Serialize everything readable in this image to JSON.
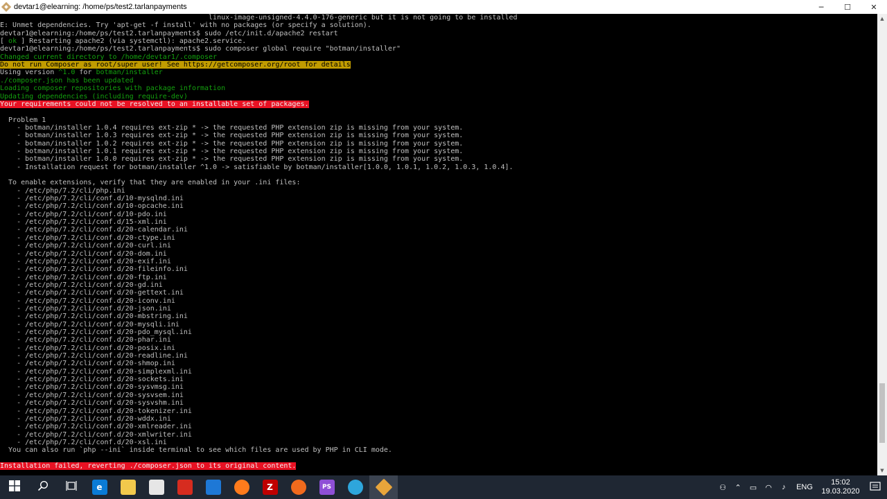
{
  "window": {
    "title": "devtar1@elearning: /home/ps/test2.tarlanpayments",
    "icon": "git-bash-icon",
    "controls": {
      "minimize": "─",
      "maximize": "☐",
      "close": "✕"
    }
  },
  "terminal": {
    "lines": [
      {
        "text": "                                                  linux-image-unsigned-4.4.0-176-generic but it is not going to be installed",
        "style": "normal"
      },
      {
        "text": "E: Unmet dependencies. Try 'apt-get -f install' with no packages (or specify a solution).",
        "style": "normal"
      },
      {
        "text": "devtar1@elearning:/home/ps/test2.tarlanpayments$ sudo /etc/init.d/apache2 restart",
        "style": "normal"
      },
      {
        "prefix": "[ ",
        "highlight": "ok",
        "suffix": " ] Restarting apache2 (via systemctl): apache2.service.",
        "style": "ok"
      },
      {
        "text": "devtar1@elearning:/home/ps/test2.tarlanpayments$ sudo composer global require \"botman/installer\"",
        "style": "normal"
      },
      {
        "text": "Changed current directory to /home/devtar1/.composer",
        "style": "green"
      },
      {
        "text": "Do not run Composer as root/super user! See https://getcomposer.org/root for details",
        "style": "warning"
      },
      {
        "prefix": "Using version ",
        "highlight": "^1.0",
        "middle": " for ",
        "highlight2": "botman/installer",
        "style": "version"
      },
      {
        "text": "./composer.json has been updated",
        "style": "green"
      },
      {
        "text": "Loading composer repositories with package information",
        "style": "green"
      },
      {
        "text": "Updating dependencies (including require-dev)",
        "style": "green"
      },
      {
        "text": "Your requirements could not be resolved to an installable set of packages.",
        "style": "error"
      },
      {
        "text": "",
        "style": "normal"
      },
      {
        "text": "  Problem 1",
        "style": "normal"
      },
      {
        "text": "    - botman/installer 1.0.4 requires ext-zip * -> the requested PHP extension zip is missing from your system.",
        "style": "normal"
      },
      {
        "text": "    - botman/installer 1.0.3 requires ext-zip * -> the requested PHP extension zip is missing from your system.",
        "style": "normal"
      },
      {
        "text": "    - botman/installer 1.0.2 requires ext-zip * -> the requested PHP extension zip is missing from your system.",
        "style": "normal"
      },
      {
        "text": "    - botman/installer 1.0.1 requires ext-zip * -> the requested PHP extension zip is missing from your system.",
        "style": "normal"
      },
      {
        "text": "    - botman/installer 1.0.0 requires ext-zip * -> the requested PHP extension zip is missing from your system.",
        "style": "normal"
      },
      {
        "text": "    - Installation request for botman/installer ^1.0 -> satisfiable by botman/installer[1.0.0, 1.0.1, 1.0.2, 1.0.3, 1.0.4].",
        "style": "normal"
      },
      {
        "text": "",
        "style": "normal"
      },
      {
        "text": "  To enable extensions, verify that they are enabled in your .ini files:",
        "style": "normal"
      },
      {
        "text": "    - /etc/php/7.2/cli/php.ini",
        "style": "normal"
      },
      {
        "text": "    - /etc/php/7.2/cli/conf.d/10-mysqlnd.ini",
        "style": "normal"
      },
      {
        "text": "    - /etc/php/7.2/cli/conf.d/10-opcache.ini",
        "style": "normal"
      },
      {
        "text": "    - /etc/php/7.2/cli/conf.d/10-pdo.ini",
        "style": "normal"
      },
      {
        "text": "    - /etc/php/7.2/cli/conf.d/15-xml.ini",
        "style": "normal"
      },
      {
        "text": "    - /etc/php/7.2/cli/conf.d/20-calendar.ini",
        "style": "normal"
      },
      {
        "text": "    - /etc/php/7.2/cli/conf.d/20-ctype.ini",
        "style": "normal"
      },
      {
        "text": "    - /etc/php/7.2/cli/conf.d/20-curl.ini",
        "style": "normal"
      },
      {
        "text": "    - /etc/php/7.2/cli/conf.d/20-dom.ini",
        "style": "normal"
      },
      {
        "text": "    - /etc/php/7.2/cli/conf.d/20-exif.ini",
        "style": "normal"
      },
      {
        "text": "    - /etc/php/7.2/cli/conf.d/20-fileinfo.ini",
        "style": "normal"
      },
      {
        "text": "    - /etc/php/7.2/cli/conf.d/20-ftp.ini",
        "style": "normal"
      },
      {
        "text": "    - /etc/php/7.2/cli/conf.d/20-gd.ini",
        "style": "normal"
      },
      {
        "text": "    - /etc/php/7.2/cli/conf.d/20-gettext.ini",
        "style": "normal"
      },
      {
        "text": "    - /etc/php/7.2/cli/conf.d/20-iconv.ini",
        "style": "normal"
      },
      {
        "text": "    - /etc/php/7.2/cli/conf.d/20-json.ini",
        "style": "normal"
      },
      {
        "text": "    - /etc/php/7.2/cli/conf.d/20-mbstring.ini",
        "style": "normal"
      },
      {
        "text": "    - /etc/php/7.2/cli/conf.d/20-mysqli.ini",
        "style": "normal"
      },
      {
        "text": "    - /etc/php/7.2/cli/conf.d/20-pdo_mysql.ini",
        "style": "normal"
      },
      {
        "text": "    - /etc/php/7.2/cli/conf.d/20-phar.ini",
        "style": "normal"
      },
      {
        "text": "    - /etc/php/7.2/cli/conf.d/20-posix.ini",
        "style": "normal"
      },
      {
        "text": "    - /etc/php/7.2/cli/conf.d/20-readline.ini",
        "style": "normal"
      },
      {
        "text": "    - /etc/php/7.2/cli/conf.d/20-shmop.ini",
        "style": "normal"
      },
      {
        "text": "    - /etc/php/7.2/cli/conf.d/20-simplexml.ini",
        "style": "normal"
      },
      {
        "text": "    - /etc/php/7.2/cli/conf.d/20-sockets.ini",
        "style": "normal"
      },
      {
        "text": "    - /etc/php/7.2/cli/conf.d/20-sysvmsg.ini",
        "style": "normal"
      },
      {
        "text": "    - /etc/php/7.2/cli/conf.d/20-sysvsem.ini",
        "style": "normal"
      },
      {
        "text": "    - /etc/php/7.2/cli/conf.d/20-sysvshm.ini",
        "style": "normal"
      },
      {
        "text": "    - /etc/php/7.2/cli/conf.d/20-tokenizer.ini",
        "style": "normal"
      },
      {
        "text": "    - /etc/php/7.2/cli/conf.d/20-wddx.ini",
        "style": "normal"
      },
      {
        "text": "    - /etc/php/7.2/cli/conf.d/20-xmlreader.ini",
        "style": "normal"
      },
      {
        "text": "    - /etc/php/7.2/cli/conf.d/20-xmlwriter.ini",
        "style": "normal"
      },
      {
        "text": "    - /etc/php/7.2/cli/conf.d/20-xsl.ini",
        "style": "normal"
      },
      {
        "text": "  You can also run `php --ini` inside terminal to see which files are used by PHP in CLI mode.",
        "style": "normal"
      },
      {
        "text": "",
        "style": "normal"
      },
      {
        "text": "Installation failed, reverting ./composer.json to its original content.",
        "style": "error"
      }
    ],
    "colors": {
      "foreground": "#c0c0c0",
      "green": "#13a10e",
      "warning_bg": "#c19c00",
      "error_bg": "#e81123"
    },
    "scroll_position_fraction": 0.94
  },
  "taskbar": {
    "apps": [
      {
        "name": "start-button",
        "icon": "windows-logo-icon"
      },
      {
        "name": "search-button",
        "icon": "search-icon"
      },
      {
        "name": "task-view-button",
        "icon": "task-view-icon"
      },
      {
        "name": "edge-app",
        "icon": "edge-icon",
        "glyph": "e",
        "color": "#0a7bd6"
      },
      {
        "name": "file-explorer-app",
        "icon": "folder-icon",
        "color": "#f2c94c"
      },
      {
        "name": "store-app",
        "icon": "store-icon",
        "color": "#e6e6e6"
      },
      {
        "name": "gift-app",
        "icon": "gift-icon",
        "color": "#d62c1f"
      },
      {
        "name": "mail-app",
        "icon": "mail-icon",
        "color": "#1e78d6"
      },
      {
        "name": "firefox-app",
        "icon": "firefox-icon",
        "color": "#ff7b1c"
      },
      {
        "name": "filezilla-app",
        "icon": "filezilla-icon",
        "glyph": "Z",
        "color": "#bf0000"
      },
      {
        "name": "orange-app",
        "icon": "compass-icon",
        "color": "#f06a1d"
      },
      {
        "name": "phpstorm-app",
        "icon": "phpstorm-icon",
        "glyph": "PS",
        "color": "#8e4fd6"
      },
      {
        "name": "telegram-app",
        "icon": "telegram-icon",
        "color": "#2ea6dc"
      },
      {
        "name": "git-bash-app",
        "icon": "git-bash-icon",
        "active": true,
        "color": "#e8a53b"
      }
    ],
    "tray": {
      "language": "ENG",
      "time": "15:02",
      "date": "19.03.2020"
    }
  }
}
